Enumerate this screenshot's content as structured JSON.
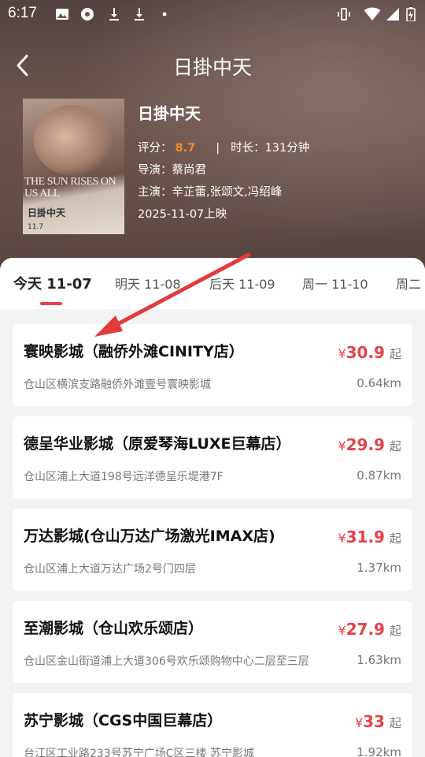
{
  "status": {
    "time": "6:17"
  },
  "header": {
    "title": "日掛中天"
  },
  "movie": {
    "name": "日掛中天",
    "score_label": "评分：",
    "score": "8.7",
    "duration_label": "时长：",
    "duration": "131分钟",
    "director_label": "导演：",
    "director": "蔡尚君",
    "cast_label": "主演：",
    "cast": "辛芷蕾,张颂文,冯绍峰",
    "release": "2025-11-07上映",
    "poster_title": "THE SUN RISES ON US ALL",
    "poster_title_cn": "日掛中天",
    "poster_date": "11.7"
  },
  "tabs": [
    {
      "label": "今天 11-07",
      "active": true
    },
    {
      "label": "明天 11-08"
    },
    {
      "label": "后天 11-09"
    },
    {
      "label": "周一 11-10"
    },
    {
      "label": "周二"
    }
  ],
  "currency_symbol": "¥",
  "from_label": "起",
  "cinemas": [
    {
      "name": "寰映影城（融侨外滩CINITY店）",
      "address": "仓山区横滨支路融侨外滩壹号寰映影城",
      "price": "30.9",
      "distance": "0.64km"
    },
    {
      "name": "德呈华业影城（原爱琴海LUXE巨幕店）",
      "address": "仓山区浦上大道198号远洋德呈乐堤港7F",
      "price": "29.9",
      "distance": "0.87km"
    },
    {
      "name": "万达影城(仓山万达广场激光IMAX店)",
      "address": "仓山区浦上大道万达广场2号门四层",
      "price": "31.9",
      "distance": "1.37km"
    },
    {
      "name": "至潮影城（仓山欢乐颂店）",
      "address": "仓山区金山街道浦上大道306号欢乐颂购物中心二层至三层",
      "price": "27.9",
      "distance": "1.63km"
    },
    {
      "name": "苏宁影城（CGS中国巨幕店）",
      "address": "台江区工业路233号苏宁广场C区三楼 苏宁影城",
      "price": "33",
      "distance": "1.92km"
    }
  ],
  "colors": {
    "accent": "#e8404a",
    "score": "#f28b2d",
    "annotation_arrow": "#e23b3b"
  }
}
